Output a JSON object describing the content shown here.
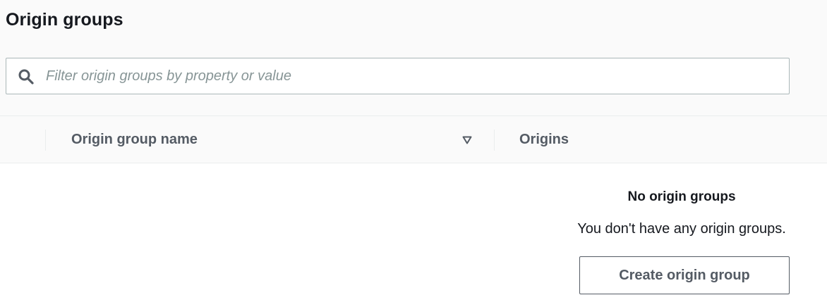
{
  "page": {
    "title": "Origin groups"
  },
  "search": {
    "placeholder": "Filter origin groups by property or value",
    "value": "",
    "icon": "search-icon"
  },
  "table": {
    "columns": [
      {
        "label": "Origin group name",
        "sortable": true,
        "sort_icon": "sort-down-icon"
      },
      {
        "label": "Origins",
        "sortable": false
      }
    ]
  },
  "empty_state": {
    "title": "No origin groups",
    "description": "You don't have any origin groups.",
    "button_label": "Create origin group"
  },
  "colors": {
    "header_background": "#fafafa",
    "text_primary": "#16191f",
    "text_secondary": "#545b64",
    "placeholder": "#879596",
    "border": "#aab7b8",
    "divider": "#eaeded"
  }
}
